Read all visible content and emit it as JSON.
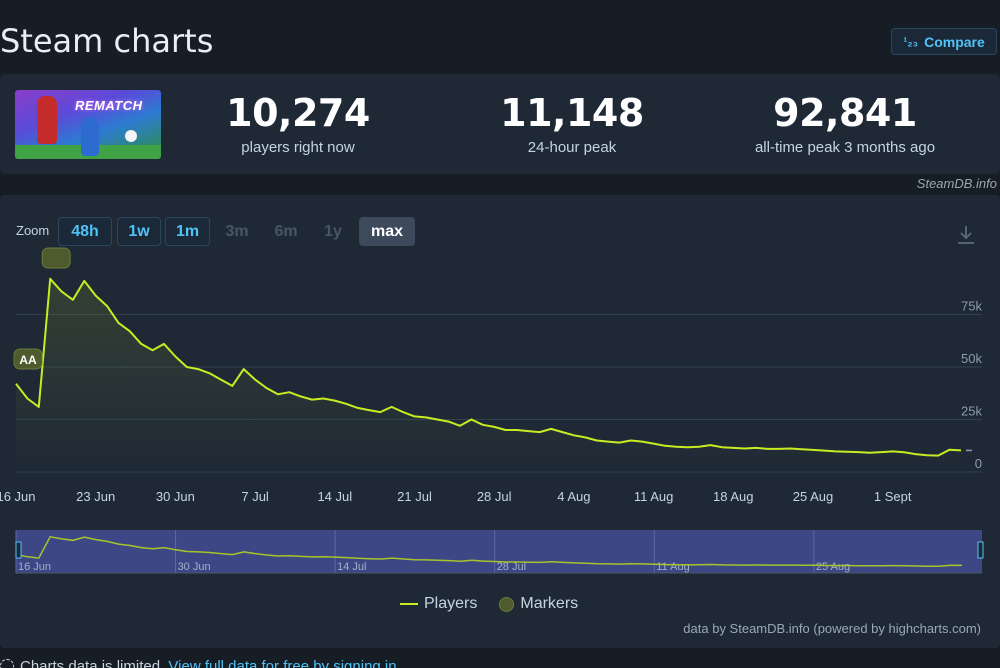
{
  "page": {
    "title": "Steam charts",
    "compare_label": "Compare",
    "compare_icon": "numbers-icon"
  },
  "game": {
    "thumb_title": "REMATCH"
  },
  "stats": [
    {
      "value": "10,274",
      "label": "players right now"
    },
    {
      "value": "11,148",
      "label": "24-hour peak"
    },
    {
      "value": "92,841",
      "label": "all-time peak 3 months ago"
    }
  ],
  "watermark": "SteamDB.info",
  "zoom": {
    "label": "Zoom",
    "buttons": [
      {
        "label": "48h",
        "state": "enabled"
      },
      {
        "label": "1w",
        "state": "enabled"
      },
      {
        "label": "1m",
        "state": "enabled"
      },
      {
        "label": "3m",
        "state": "disabled"
      },
      {
        "label": "6m",
        "state": "disabled"
      },
      {
        "label": "1y",
        "state": "disabled"
      },
      {
        "label": "max",
        "state": "selected"
      }
    ]
  },
  "legend": {
    "players": "Players",
    "markers": "Markers"
  },
  "credits": "data by SteamDB.info (powered by highcharts.com)",
  "footer": {
    "text": "Charts data is limited.",
    "link": "View full data for free by signing in"
  },
  "colors": {
    "line": "#c7ec22",
    "background": "#1f2936",
    "accent": "#4fc3f7"
  },
  "chart_data": {
    "type": "line",
    "series": [
      {
        "name": "Players",
        "points": [
          [
            "16 Jun",
            42000
          ],
          [
            "17 Jun",
            35000
          ],
          [
            "18 Jun",
            31000
          ],
          [
            "19 Jun",
            92000
          ],
          [
            "20 Jun",
            86000
          ],
          [
            "21 Jun",
            82000
          ],
          [
            "22 Jun",
            91000
          ],
          [
            "23 Jun",
            84000
          ],
          [
            "24 Jun",
            79000
          ],
          [
            "25 Jun",
            71000
          ],
          [
            "26 Jun",
            67000
          ],
          [
            "27 Jun",
            61000
          ],
          [
            "28 Jun",
            58000
          ],
          [
            "29 Jun",
            61000
          ],
          [
            "30 Jun",
            55000
          ],
          [
            "1 Jul",
            50000
          ],
          [
            "2 Jul",
            49000
          ],
          [
            "3 Jul",
            47000
          ],
          [
            "4 Jul",
            44000
          ],
          [
            "5 Jul",
            41000
          ],
          [
            "6 Jul",
            49000
          ],
          [
            "7 Jul",
            44000
          ],
          [
            "8 Jul",
            40000
          ],
          [
            "9 Jul",
            37000
          ],
          [
            "10 Jul",
            38000
          ],
          [
            "11 Jul",
            36000
          ],
          [
            "12 Jul",
            34500
          ],
          [
            "13 Jul",
            35000
          ],
          [
            "14 Jul",
            34000
          ],
          [
            "15 Jul",
            32500
          ],
          [
            "16 Jul",
            30500
          ],
          [
            "17 Jul",
            29500
          ],
          [
            "18 Jul",
            28500
          ],
          [
            "19 Jul",
            31000
          ],
          [
            "20 Jul",
            28500
          ],
          [
            "21 Jul",
            26500
          ],
          [
            "22 Jul",
            26000
          ],
          [
            "23 Jul",
            25000
          ],
          [
            "24 Jul",
            24000
          ],
          [
            "25 Jul",
            22000
          ],
          [
            "26 Jul",
            25000
          ],
          [
            "27 Jul",
            22500
          ],
          [
            "28 Jul",
            21500
          ],
          [
            "29 Jul",
            20000
          ],
          [
            "30 Jul",
            20000
          ],
          [
            "31 Jul",
            19500
          ],
          [
            "1 Aug",
            19000
          ],
          [
            "2 Aug",
            20500
          ],
          [
            "3 Aug",
            19000
          ],
          [
            "4 Aug",
            17500
          ],
          [
            "5 Aug",
            16500
          ],
          [
            "6 Aug",
            15000
          ],
          [
            "7 Aug",
            14500
          ],
          [
            "8 Aug",
            14000
          ],
          [
            "9 Aug",
            15000
          ],
          [
            "10 Aug",
            14500
          ],
          [
            "11 Aug",
            13500
          ],
          [
            "12 Aug",
            12500
          ],
          [
            "13 Aug",
            12000
          ],
          [
            "14 Aug",
            11800
          ],
          [
            "15 Aug",
            12000
          ],
          [
            "16 Aug",
            12800
          ],
          [
            "17 Aug",
            11800
          ],
          [
            "18 Aug",
            11500
          ],
          [
            "19 Aug",
            11200
          ],
          [
            "20 Aug",
            11500
          ],
          [
            "21 Aug",
            11000
          ],
          [
            "22 Aug",
            11000
          ],
          [
            "23 Aug",
            11200
          ],
          [
            "24 Aug",
            10800
          ],
          [
            "25 Aug",
            10500
          ],
          [
            "26 Aug",
            10200
          ],
          [
            "27 Aug",
            9800
          ],
          [
            "28 Aug",
            9600
          ],
          [
            "29 Aug",
            9500
          ],
          [
            "30 Aug",
            9200
          ],
          [
            "31 Aug",
            9500
          ],
          [
            "1 Sept",
            9800
          ],
          [
            "2 Sept",
            9400
          ],
          [
            "3 Sept",
            8500
          ],
          [
            "4 Sept",
            8000
          ],
          [
            "5 Sept",
            7800
          ],
          [
            "6 Sept",
            10600
          ],
          [
            "7 Sept",
            10274
          ]
        ]
      }
    ],
    "markers": [
      {
        "label": "AA",
        "date": "16 Jun"
      },
      {
        "label": "",
        "date": "19 Jun"
      }
    ],
    "x_ticks": [
      "16 Jun",
      "23 Jun",
      "30 Jun",
      "7 Jul",
      "14 Jul",
      "21 Jul",
      "28 Jul",
      "4 Aug",
      "11 Aug",
      "18 Aug",
      "25 Aug",
      "1 Sept"
    ],
    "y_ticks": [
      "0",
      "25k",
      "50k",
      "75k"
    ],
    "ylim": [
      0,
      100000
    ],
    "navigator_ticks": [
      "16 Jun",
      "30 Jun",
      "14 Jul",
      "28 Jul",
      "11 Aug",
      "25 Aug"
    ],
    "grid": true,
    "legend_position": "bottom-center"
  }
}
